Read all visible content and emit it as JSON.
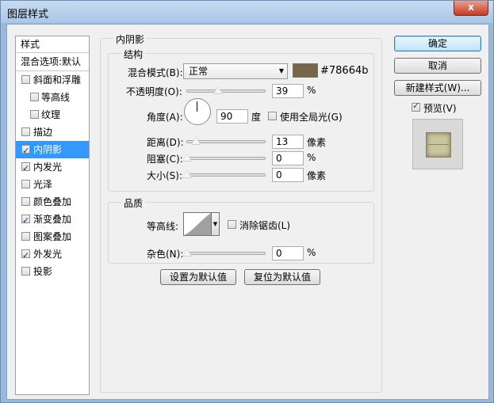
{
  "window": {
    "title": "图层样式",
    "close_label": "x"
  },
  "left_panel": {
    "header": "样式",
    "blend_options": "混合选项:默认",
    "items": [
      {
        "label": "斜面和浮雕",
        "checked": false,
        "indent": false,
        "selected": false
      },
      {
        "label": "等高线",
        "checked": false,
        "indent": true,
        "selected": false
      },
      {
        "label": "纹理",
        "checked": false,
        "indent": true,
        "selected": false
      },
      {
        "label": "描边",
        "checked": false,
        "indent": false,
        "selected": false
      },
      {
        "label": "内阴影",
        "checked": true,
        "indent": false,
        "selected": true
      },
      {
        "label": "内发光",
        "checked": true,
        "indent": false,
        "selected": false
      },
      {
        "label": "光泽",
        "checked": false,
        "indent": false,
        "selected": false
      },
      {
        "label": "颜色叠加",
        "checked": false,
        "indent": false,
        "selected": false
      },
      {
        "label": "渐变叠加",
        "checked": true,
        "indent": false,
        "selected": false
      },
      {
        "label": "图案叠加",
        "checked": false,
        "indent": false,
        "selected": false
      },
      {
        "label": "外发光",
        "checked": true,
        "indent": false,
        "selected": false
      },
      {
        "label": "投影",
        "checked": false,
        "indent": false,
        "selected": false
      }
    ]
  },
  "inner_shadow": {
    "title": "内阴影",
    "structure": {
      "title": "结构",
      "blend_mode_label": "混合模式(B):",
      "blend_mode_value": "正常",
      "color_hex": "#78664b",
      "color_text": "#78664b",
      "opacity_label": "不透明度(O):",
      "opacity_value": "39",
      "opacity_unit": "%",
      "opacity_fraction": 0.39,
      "angle_label": "角度(A):",
      "angle_value": "90",
      "angle_unit": "度",
      "global_light_label": "使用全局光(G)",
      "global_light_checked": false,
      "distance_label": "距离(D):",
      "distance_value": "13",
      "distance_unit": "像素",
      "choke_label": "阻塞(C):",
      "choke_value": "0",
      "choke_unit": "%",
      "size_label": "大小(S):",
      "size_value": "0",
      "size_unit": "像素"
    },
    "quality": {
      "title": "品质",
      "contour_label": "等高线:",
      "anti_alias_label": "消除锯齿(L)",
      "anti_alias_checked": false,
      "noise_label": "杂色(N):",
      "noise_value": "0",
      "noise_unit": "%"
    },
    "make_default": "设置为默认值",
    "reset_default": "复位为默认值"
  },
  "right_buttons": {
    "ok": "确定",
    "cancel": "取消",
    "new_style": "新建样式(W)...",
    "preview_label": "预览(V)",
    "preview_checked": true
  }
}
